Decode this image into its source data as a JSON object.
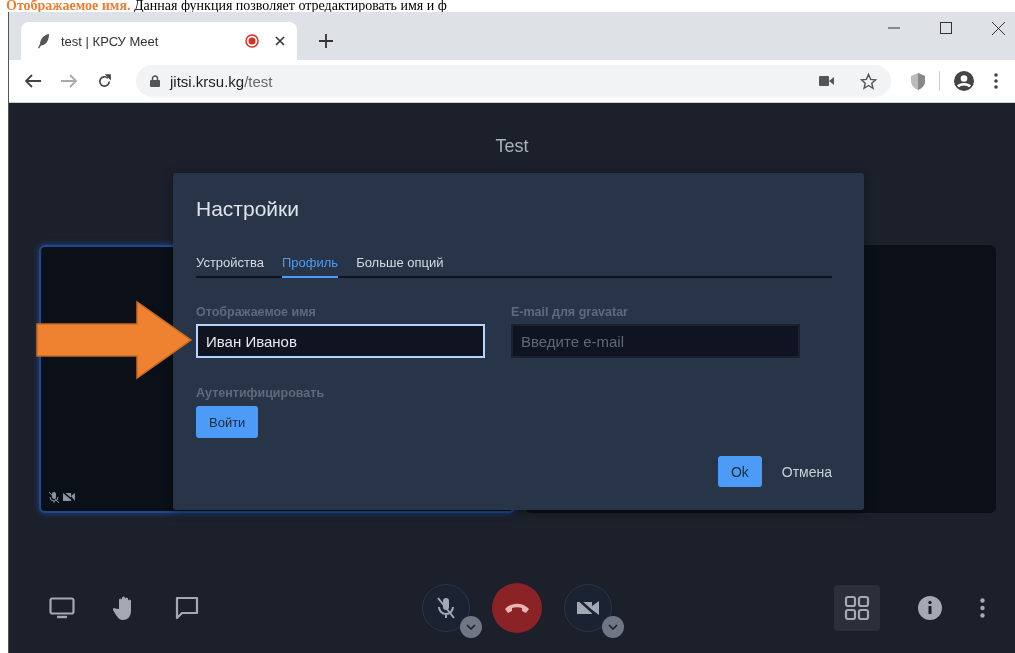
{
  "document_text": {
    "heading": "Отображаемое имя.",
    "body": "Данная функция позволяет отредактировать имя и ф"
  },
  "browser": {
    "tab": {
      "title": "test | КРСУ Meet",
      "recording": true
    },
    "url": {
      "host": "jitsi.krsu.kg",
      "path": "/test"
    }
  },
  "meeting": {
    "title": "Test",
    "tiles": [
      {
        "selected": true,
        "status_icons": true
      },
      {
        "selected": false
      }
    ]
  },
  "dialog": {
    "title": "Настройки",
    "tabs": [
      {
        "label": "Устройства",
        "selected": false
      },
      {
        "label": "Профиль",
        "selected": true
      },
      {
        "label": "Больше опций",
        "selected": false
      }
    ],
    "fields": [
      {
        "label": "Отображаемое имя",
        "value": "Иван Иванов",
        "focused": true
      },
      {
        "label": "E-mail для gravatar",
        "placeholder": "Введите e-mail",
        "focused": false
      }
    ],
    "auth": {
      "label": "Аутентифицировать",
      "button": "Войти"
    },
    "buttons": [
      {
        "label": "Ok",
        "kind": "primary"
      },
      {
        "label": "Отмена",
        "kind": "secondary"
      }
    ]
  },
  "toolbar": {
    "mic_muted": true,
    "camera_muted": true,
    "tile_view": true
  }
}
